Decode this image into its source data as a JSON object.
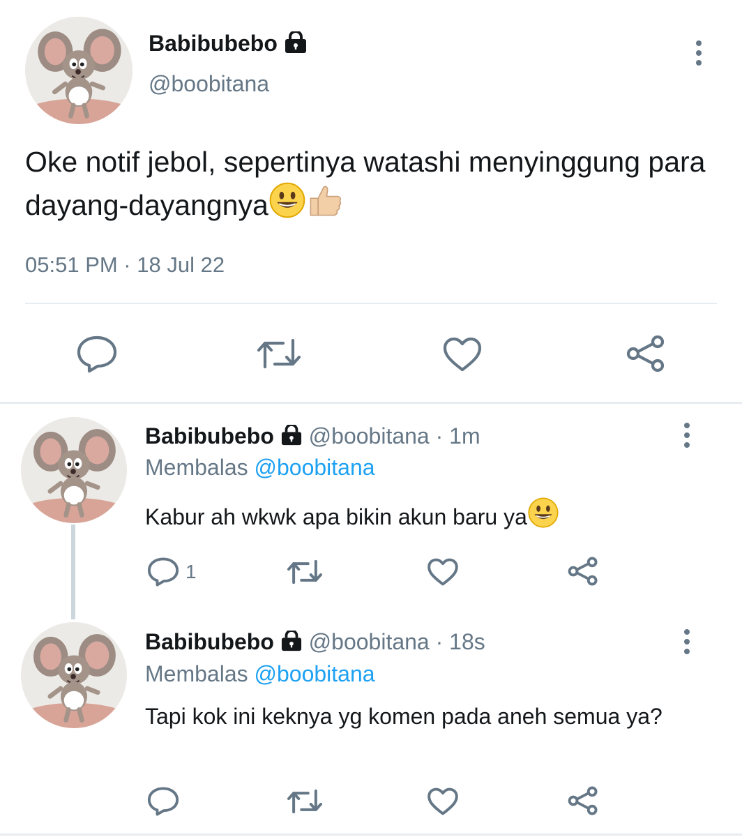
{
  "main_tweet": {
    "display_name": "Babibubebo",
    "handle": "@boobitana",
    "text": "Oke notif jebol, sepertinya watashi menyinggung para dayang-dayangnya",
    "emojis": [
      "grinning-face",
      "thumbs-up-light-skin"
    ],
    "timestamp": "05:51 PM · 18 Jul 22"
  },
  "replies": [
    {
      "display_name": "Babibubebo",
      "handle": "@boobitana",
      "time_sep": "·",
      "time": "1m",
      "replying_prefix": "Membalas",
      "replying_to": "@boobitana",
      "text": "Kabur ah wkwk apa bikin akun baru ya",
      "emoji": "grinning-face",
      "reply_count": "1"
    },
    {
      "display_name": "Babibubebo",
      "handle": "@boobitana",
      "time_sep": "·",
      "time": "18s",
      "replying_prefix": "Membalas",
      "replying_to": "@boobitana",
      "text": "Tapi kok ini keknya yg komen pada aneh semua ya?",
      "reply_count": ""
    }
  ],
  "icons": [
    "lock-icon",
    "more-icon",
    "reply-icon",
    "retweet-icon",
    "like-icon",
    "share-icon"
  ],
  "colors": {
    "icon": "#657786",
    "link": "#1da1f2",
    "divider": "#e6ecf0",
    "thread": "#ccd6dd"
  }
}
